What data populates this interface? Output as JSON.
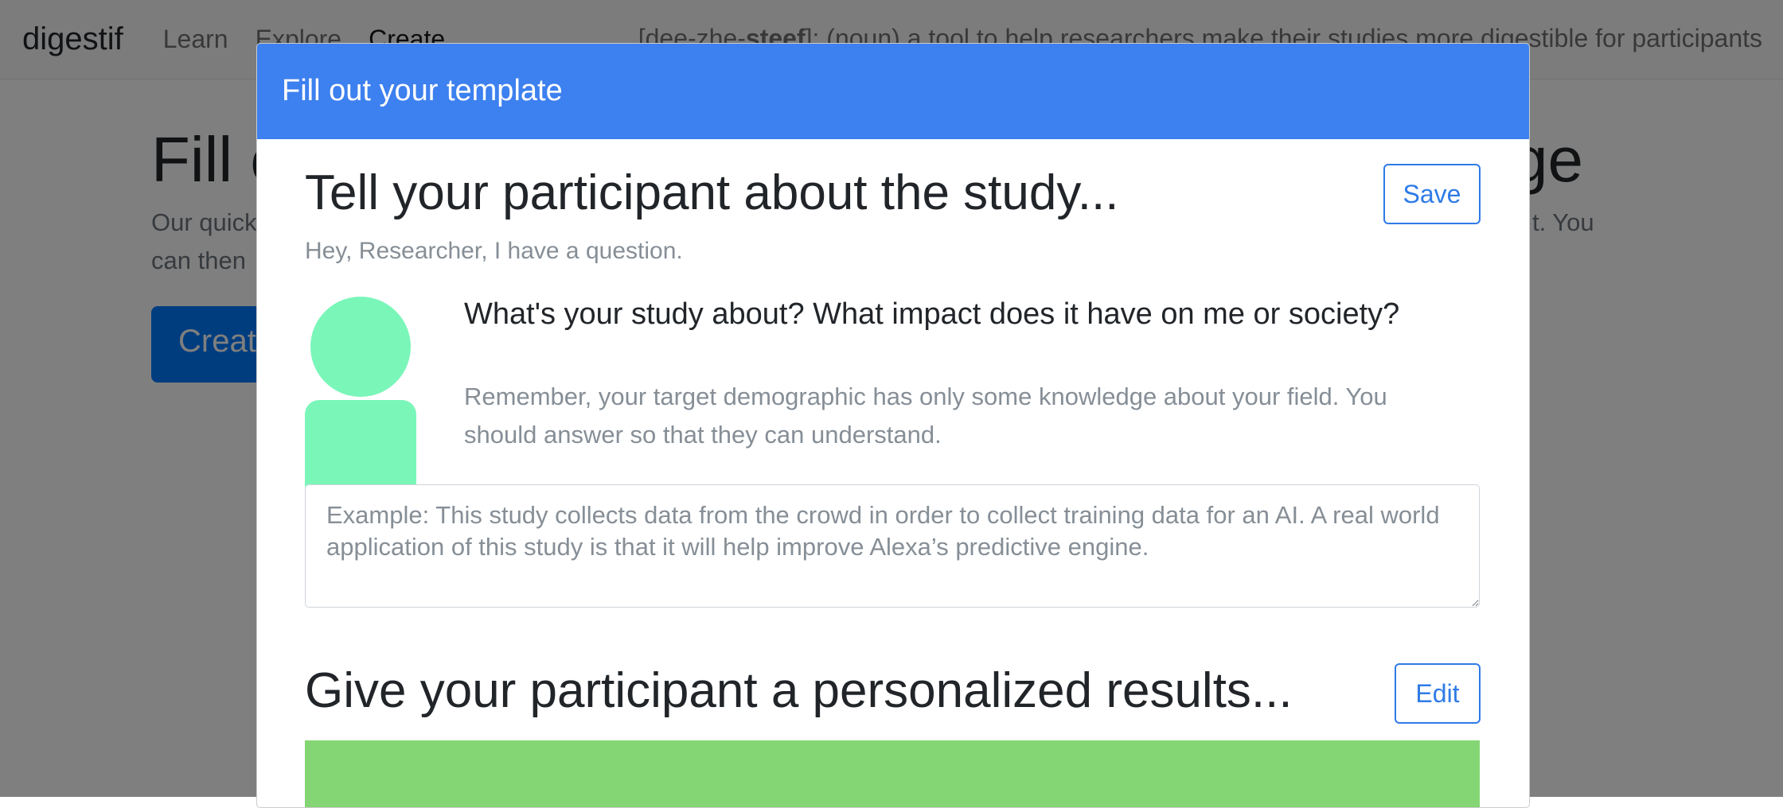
{
  "navbar": {
    "brand": "digestif",
    "links": [
      "Learn",
      "Explore",
      "Create"
    ],
    "tagline_prefix": "[dee-zhe-",
    "tagline_bold": "steef",
    "tagline_suffix": "]: (noun) a tool to help researchers make their studies more digestible for participants"
  },
  "background": {
    "title_left": "Fill o",
    "title_right": "ge",
    "lead_line1_left": "Our quick",
    "lead_line1_right": "t. You",
    "lead_line2_left": "can then",
    "button_label": "Create"
  },
  "modal": {
    "header": "Fill out your template",
    "section1": {
      "title": "Tell your participant about the study...",
      "save_label": "Save",
      "subtitle": "Hey, Researcher, I have a question.",
      "question": "What's your study about? What impact does it have on me or society?",
      "hint": "Remember, your target demographic has only some knowledge about your field. You should answer so that they can understand.",
      "answer_value": "",
      "answer_placeholder": "Example: This study collects data from the crowd in order to collect training data for an AI. A real world application of this study is that it will help improve Alexa’s predictive engine."
    },
    "section2": {
      "title": "Give your participant a personalized results...",
      "edit_label": "Edit"
    }
  },
  "colors": {
    "modal_header": "#3d80ef",
    "avatar": "#7af6b9",
    "results_banner": "#84d674",
    "outline_button": "#2f7be6"
  }
}
